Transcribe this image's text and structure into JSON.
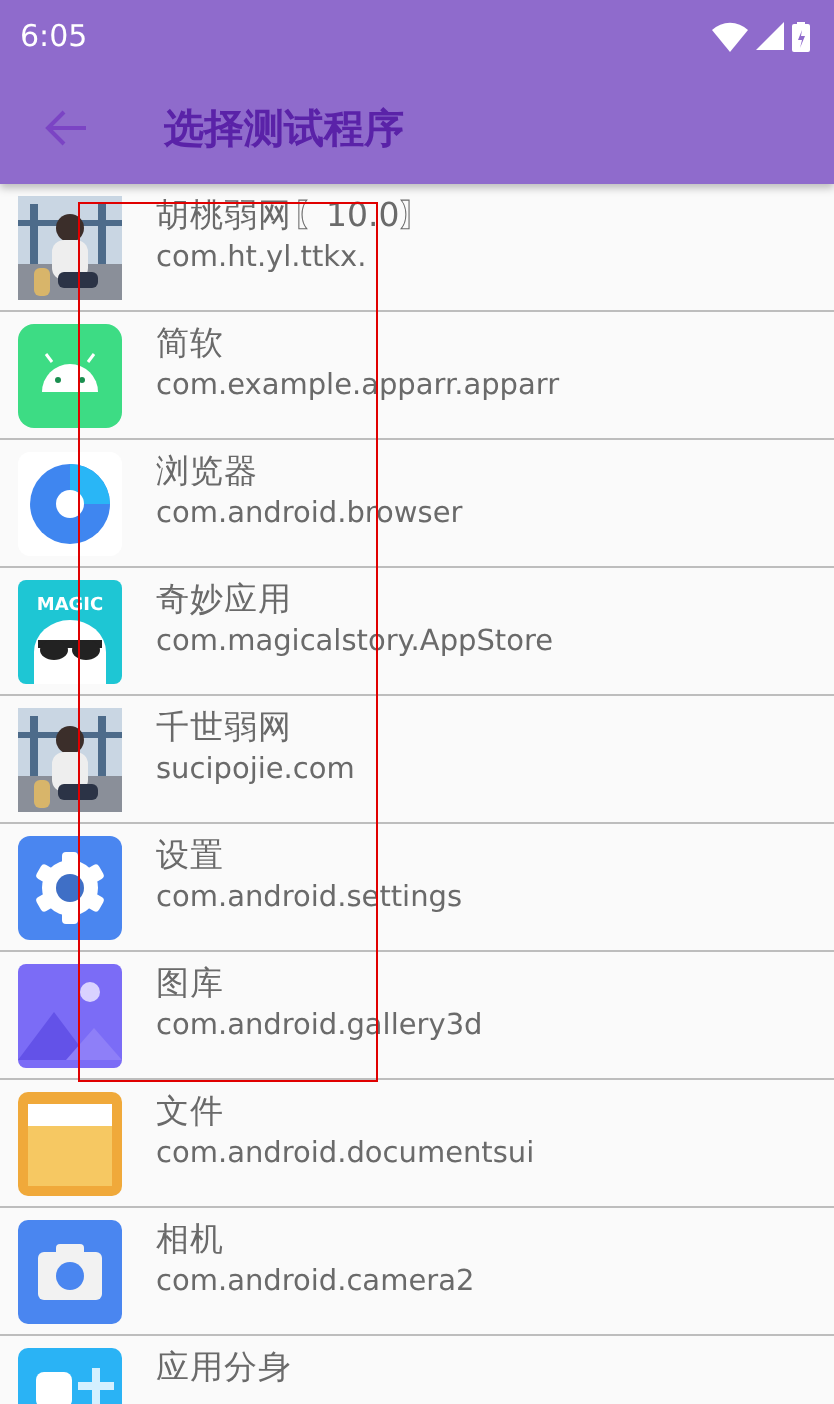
{
  "status_bar": {
    "time": "6:05"
  },
  "toolbar": {
    "title": "选择测试程序"
  },
  "apps": [
    {
      "kind": "picture",
      "name": "胡桃弱网〖10.0〗",
      "package": "com.ht.yl.ttkx."
    },
    {
      "kind": "android",
      "name": "简软",
      "package": "com.example.apparr.apparr"
    },
    {
      "kind": "browser",
      "name": "浏览器",
      "package": "com.android.browser"
    },
    {
      "kind": "magic",
      "icon_text": "MAGIC",
      "name": "奇妙应用",
      "package": "com.magicalstory.AppStore"
    },
    {
      "kind": "picture",
      "name": "千世弱网",
      "package": "sucipojie.com"
    },
    {
      "kind": "settings",
      "name": "设置",
      "package": "com.android.settings"
    },
    {
      "kind": "gallery",
      "name": "图库",
      "package": "com.android.gallery3d"
    },
    {
      "kind": "folder",
      "name": "文件",
      "package": "com.android.documentsui"
    },
    {
      "kind": "camera",
      "name": "相机",
      "package": "com.android.camera2"
    },
    {
      "kind": "clone",
      "name": "应用分身"
    }
  ]
}
